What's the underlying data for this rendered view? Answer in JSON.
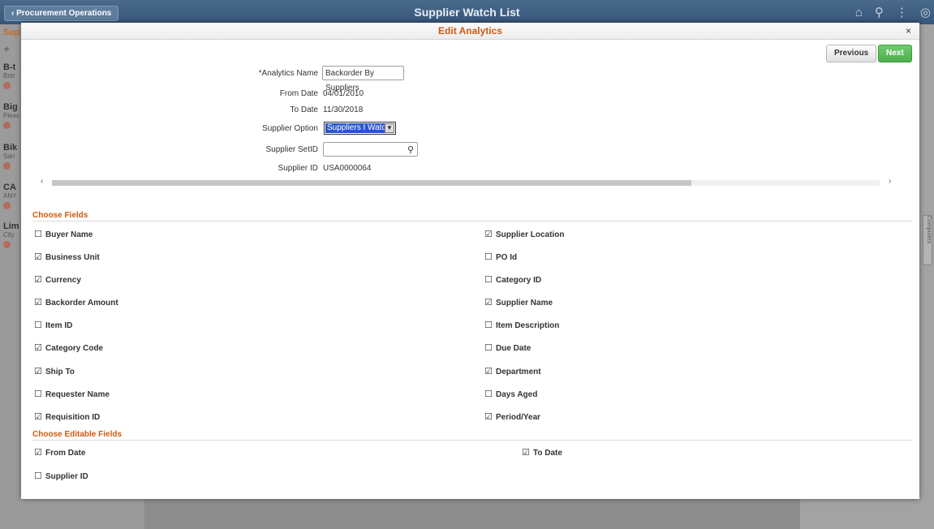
{
  "banner": {
    "back_label": "Procurement Operations",
    "title": "Supplier Watch List",
    "icons": [
      "home-icon",
      "search-icon",
      "kebab-menu-icon",
      "compass-icon"
    ]
  },
  "background": {
    "items": [
      {
        "name": "B-t",
        "sub": "Britr"
      },
      {
        "name": "Big",
        "sub": "Pleas"
      },
      {
        "name": "Bik",
        "sub": "San"
      },
      {
        "name": "CA",
        "sub": "ANY"
      },
      {
        "name": "Lim",
        "sub": "City"
      }
    ],
    "header_fragment": "Sup",
    "side_tab": "Computers"
  },
  "modal": {
    "title": "Edit Analytics",
    "close_label": "×",
    "previous_label": "Previous",
    "next_label": "Next",
    "fields": {
      "analytics_name_label": "*Analytics Name",
      "analytics_name_value": "Backorder By Suppliers",
      "from_date_label": "From Date",
      "from_date_value": "04/01/2010",
      "to_date_label": "To Date",
      "to_date_value": "11/30/2018",
      "supplier_option_label": "Supplier Option",
      "supplier_option_value": "Suppliers I Watch",
      "supplier_setid_label": "Supplier SetID",
      "supplier_setid_value": "",
      "supplier_id_label": "Supplier ID",
      "supplier_id_value": "USA0000064"
    },
    "choose_fields_title": "Choose Fields",
    "choose_fields": [
      {
        "label": "Buyer Name",
        "checked": false
      },
      {
        "label": "Supplier Location",
        "checked": true
      },
      {
        "label": "Business Unit",
        "checked": true
      },
      {
        "label": "PO Id",
        "checked": false
      },
      {
        "label": "Currency",
        "checked": true
      },
      {
        "label": "Category ID",
        "checked": false
      },
      {
        "label": "Backorder Amount",
        "checked": true
      },
      {
        "label": "Supplier Name",
        "checked": true
      },
      {
        "label": "Item ID",
        "checked": false
      },
      {
        "label": "Item Description",
        "checked": false
      },
      {
        "label": "Category Code",
        "checked": true
      },
      {
        "label": "Due Date",
        "checked": false
      },
      {
        "label": "Ship To",
        "checked": true
      },
      {
        "label": "Department",
        "checked": true
      },
      {
        "label": "Requester Name",
        "checked": false
      },
      {
        "label": "Days Aged",
        "checked": false
      },
      {
        "label": "Requisition ID",
        "checked": true
      },
      {
        "label": "Period/Year",
        "checked": true
      }
    ],
    "choose_editable_title": "Choose Editable Fields",
    "editable_fields": [
      {
        "label": "From Date",
        "checked": true
      },
      {
        "label": "To Date",
        "checked": true
      },
      {
        "label": "Supplier ID",
        "checked": false
      }
    ]
  },
  "colors": {
    "accent_orange": "#cd5a12",
    "next_green": "#4fae4f",
    "banner_blue": "#36567a"
  }
}
